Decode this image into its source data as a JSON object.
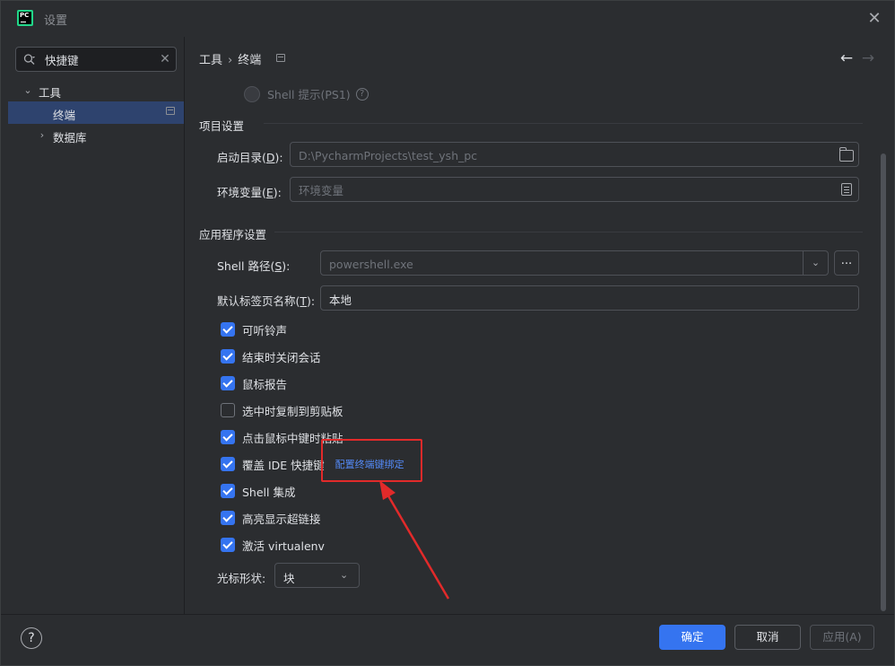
{
  "window": {
    "title": "设置",
    "app_icon_text": "PC"
  },
  "search": {
    "value": "快捷键"
  },
  "tree": {
    "items": [
      {
        "label": "工具"
      },
      {
        "label": "终端"
      },
      {
        "label": "数据库"
      }
    ]
  },
  "breadcrumb": {
    "parent": "工具",
    "separator": "›",
    "current": "终端"
  },
  "radio": {
    "label": "Shell 提示(PS1)"
  },
  "project": {
    "title": "项目设置",
    "start_dir": {
      "label_prefix": "启动目录(",
      "mnemonic": "D",
      "label_suffix": "):",
      "value": "D:\\PycharmProjects\\test_ysh_pc"
    },
    "env_vars": {
      "label_prefix": "环境变量(",
      "mnemonic": "E",
      "label_suffix": "):",
      "placeholder": "环境变量"
    }
  },
  "app": {
    "title": "应用程序设置",
    "shell_path": {
      "label_prefix": "Shell 路径(",
      "mnemonic": "S",
      "label_suffix": "):",
      "value": "powershell.exe",
      "dots": "..."
    },
    "tab_name": {
      "label_prefix": "默认标签页名称(",
      "mnemonic": "T",
      "label_suffix": "):",
      "value": "本地"
    }
  },
  "checkboxes": [
    {
      "label": "可听铃声",
      "checked": true
    },
    {
      "label": "结束时关闭会话",
      "checked": true
    },
    {
      "label": "鼠标报告",
      "checked": true
    },
    {
      "label": "选中时复制到剪贴板",
      "checked": false
    },
    {
      "label": "点击鼠标中键时粘贴",
      "checked": true
    },
    {
      "label": "覆盖 IDE 快捷键",
      "checked": true,
      "link": "配置终端键绑定"
    },
    {
      "label": "Shell 集成",
      "checked": true
    },
    {
      "label": "高亮显示超链接",
      "checked": true
    },
    {
      "label": "激活 virtualenv",
      "checked": true
    }
  ],
  "cursor_shape": {
    "label": "光标形状:",
    "value": "块"
  },
  "footer": {
    "help": "?",
    "ok": "确定",
    "cancel": "取消",
    "apply": "应用(A)"
  },
  "colors": {
    "accent": "#3574f0",
    "link": "#548af7",
    "annotation": "#e22a2a",
    "background": "#2b2d30"
  }
}
